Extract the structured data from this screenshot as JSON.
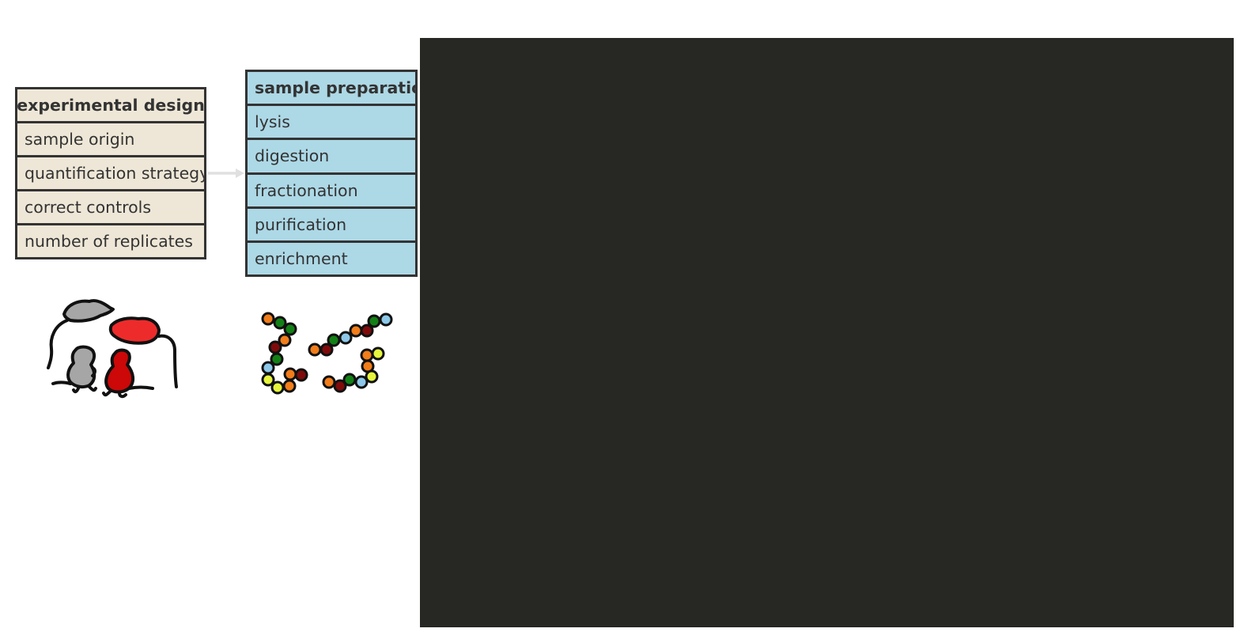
{
  "design": {
    "title": "experimental design",
    "items": [
      "sample origin",
      "quantification strategy",
      "correct controls",
      "number of replicates"
    ]
  },
  "preparation": {
    "title": "sample preparation",
    "items": [
      "lysis",
      "digestion",
      "fractionation",
      "purification",
      "enrichment"
    ]
  },
  "icons": {
    "design_illustration": "mouse-icon",
    "preparation_illustration": "peptide-chain-icon",
    "connector": "arrow-right-icon"
  },
  "colors": {
    "design_fill": "#eee7d7",
    "preparation_fill": "#add8e6",
    "border": "#333333",
    "arrow": "#e0e0e0",
    "dark_panel": "#272723",
    "mouse_grey": "#a6a6a6",
    "mouse_red": "#ee2b2b",
    "bead_orange": "#f17d1b",
    "bead_green": "#138016",
    "bead_darkred": "#7f0b0b",
    "bead_lightblue": "#8dc8e8",
    "bead_yellow": "#e6f53d"
  }
}
